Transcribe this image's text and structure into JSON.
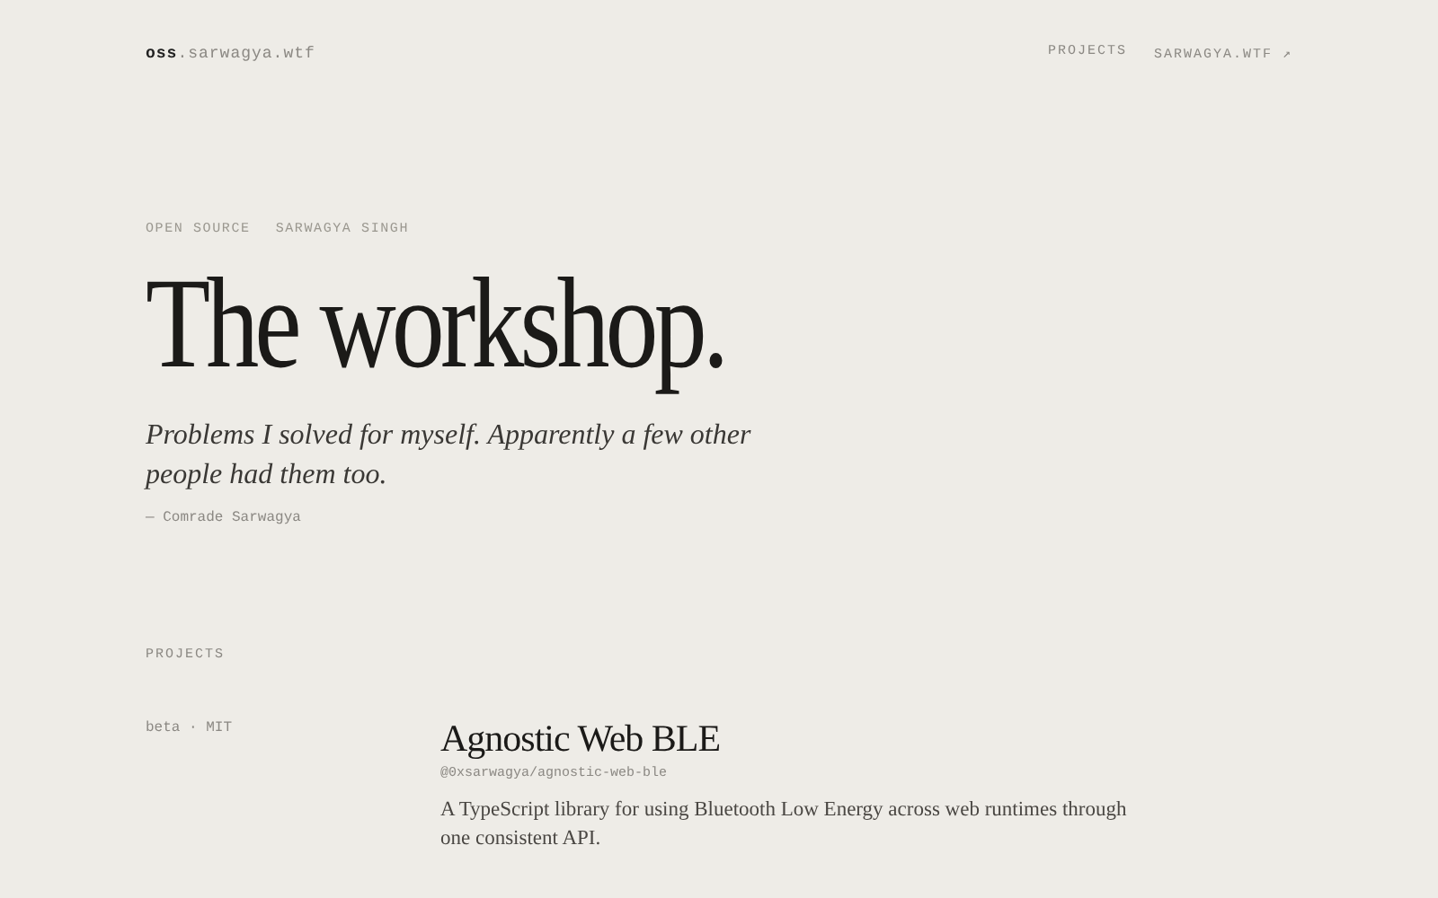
{
  "header": {
    "logo": "**oss**.sarwagya.wtf",
    "nav": [
      {
        "label": "PROJECTS"
      },
      {
        "label": "SARWAGYA.WTF ↗"
      }
    ]
  },
  "hero": {
    "eyebrow": [
      "OPEN SOURCE",
      "SARWAGYA SINGH"
    ],
    "title": "The workshop.",
    "tagline": "Problems I solved for myself. Apparently a few other people had them too.",
    "attribution": "— Comrade Sarwagya"
  },
  "projects": {
    "heading": "PROJECTS",
    "items": [
      {
        "meta": "beta · MIT",
        "name": "Agnostic Web BLE",
        "package": "@0xsarwagya/agnostic-web-ble",
        "description": "A TypeScript library for using Bluetooth Low Energy across web runtimes through one consistent API."
      }
    ]
  }
}
